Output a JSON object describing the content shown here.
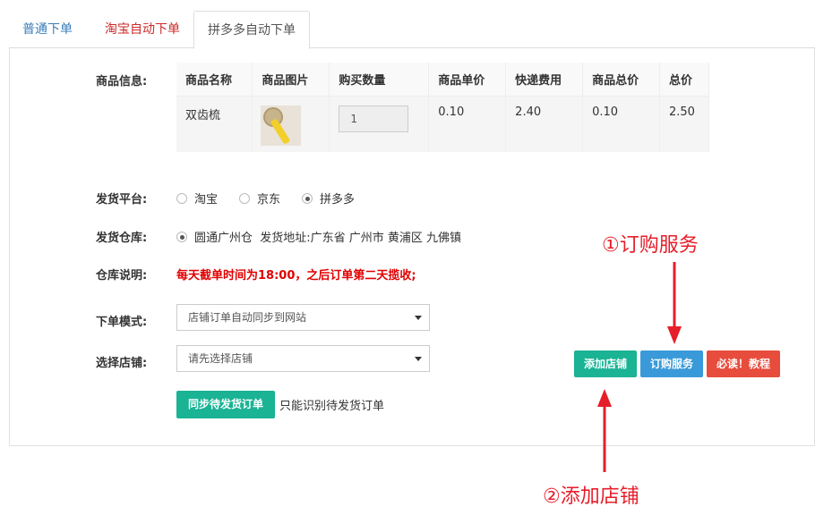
{
  "tabs": [
    {
      "label": "普通下单"
    },
    {
      "label": "淘宝自动下单"
    },
    {
      "label": "拼多多自动下单",
      "active": true
    }
  ],
  "product": {
    "label": "商品信息:",
    "headers": [
      "商品名称",
      "商品图片",
      "购买数量",
      "商品单价",
      "快递费用",
      "商品总价",
      "总价"
    ],
    "row": {
      "name": "双齿梳",
      "quantity": "1",
      "unit_price": "0.10",
      "shipping_fee": "2.40",
      "goods_total": "0.10",
      "total": "2.50"
    }
  },
  "platform": {
    "label": "发货平台:",
    "options": [
      "淘宝",
      "京东",
      "拼多多"
    ],
    "selected": "拼多多"
  },
  "warehouse": {
    "label": "发货仓库:",
    "option": "圆通广州仓  发货地址:广东省 广州市 黄浦区 九佛镇"
  },
  "warehouse_note": {
    "label": "仓库说明:",
    "text": "每天截单时间为18:00，之后订单第二天揽收;"
  },
  "order_mode": {
    "label": "下单模式:",
    "value": "店铺订单自动同步到网站"
  },
  "shop": {
    "label": "选择店铺:",
    "value": "请先选择店铺"
  },
  "buttons": {
    "sync": "同步待发货订单",
    "sync_note": "只能识别待发货订单",
    "add_shop": "添加店铺",
    "buy_service": "订购服务",
    "must_read": "必读！教程"
  },
  "annotations": {
    "step1": "①订购服务",
    "step2": "②添加店铺"
  },
  "colors": {
    "green": "#1ab394",
    "blue": "#3a9ad9",
    "red": "#e74c3c",
    "annotation": "#e61e2a",
    "warning_text": "#e00000"
  }
}
